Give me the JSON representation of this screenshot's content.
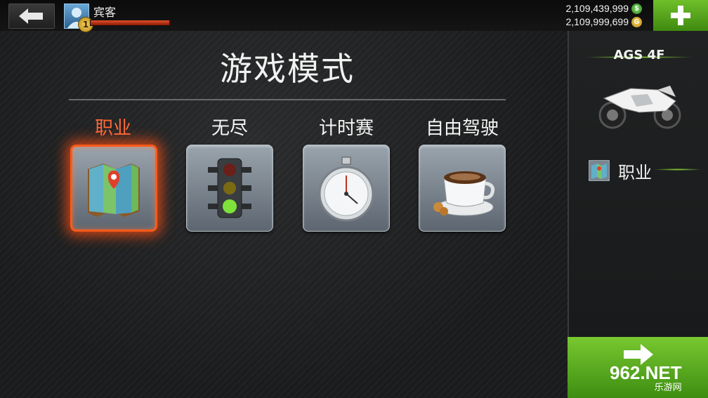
{
  "player": {
    "name": "宾客",
    "level": "1",
    "xp_fraction": 0.98
  },
  "currency": {
    "cash": "2,109,439,999",
    "cash_symbol": "$",
    "gold": "2,109,999,699",
    "gold_symbol": "G"
  },
  "page_title": "游戏模式",
  "modes": [
    {
      "label": "职业",
      "icon": "map-icon",
      "selected": true
    },
    {
      "label": "无尽",
      "icon": "traffic-light-icon",
      "selected": false
    },
    {
      "label": "计时赛",
      "icon": "stopwatch-icon",
      "selected": false
    },
    {
      "label": "自由驾驶",
      "icon": "coffee-cup-icon",
      "selected": false
    }
  ],
  "side_panel": {
    "vehicle_name": "AGS 4F",
    "selected_mode": "职业"
  },
  "watermark": {
    "main": "962.NET",
    "sub": "乐游网"
  },
  "colors": {
    "accent_orange": "#ff5a1a",
    "go_green": "#5fae22"
  }
}
